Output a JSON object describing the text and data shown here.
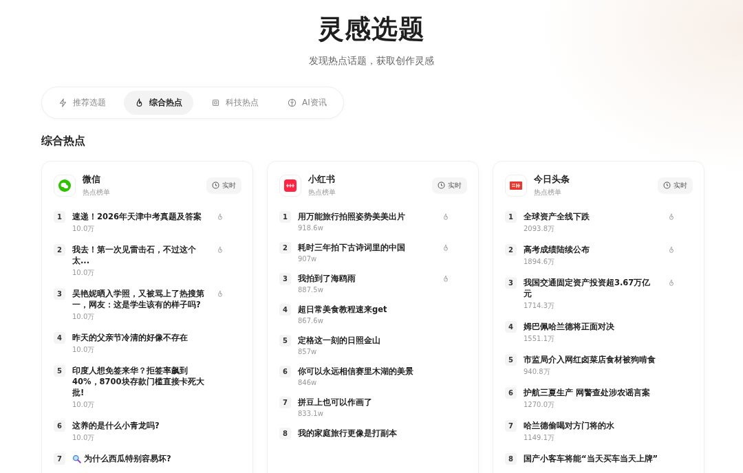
{
  "header": {
    "title": "灵感选题",
    "subtitle": "发现热点话题，获取创作灵感"
  },
  "tabs": [
    {
      "label": "推荐选题",
      "selected": false
    },
    {
      "label": "综合热点",
      "selected": true
    },
    {
      "label": "科技热点",
      "selected": false
    },
    {
      "label": "AI资讯",
      "selected": false
    }
  ],
  "section_title": "综合热点",
  "boards": [
    {
      "name": "微信",
      "subtitle": "热点榜单",
      "kind": "wechat",
      "badge": "实时",
      "items": [
        {
          "rank": "1",
          "title": "速递！2026年天津中考真题及答案",
          "count": "10.0万",
          "hot": true
        },
        {
          "rank": "2",
          "title": "我去！第一次见雷击石，不过这个太...",
          "count": "10.0万",
          "hot": true
        },
        {
          "rank": "3",
          "title": "吴艳妮晒入学照，又被骂上了热搜第一，网友：这是学生该有的样子吗?",
          "count": "10.0万",
          "hot": true
        },
        {
          "rank": "4",
          "title": "昨天的父亲节冷清的好像不存在",
          "count": "10.0万",
          "hot": false
        },
        {
          "rank": "5",
          "title": "印度人想免签来华？拒签率飙到40%，8700块存款门槛直接卡死大批!",
          "count": "10.0万",
          "hot": false
        },
        {
          "rank": "6",
          "title": "这养的是什么小青龙吗?",
          "count": "10.0万",
          "hot": false
        },
        {
          "rank": "7",
          "title": "为什么西瓜特别容易坏?",
          "search": true,
          "hot": false
        }
      ]
    },
    {
      "name": "小红书",
      "subtitle": "热点榜单",
      "kind": "xiaohongshu",
      "badge": "实时",
      "items": [
        {
          "rank": "1",
          "title": "用万能旅行拍照姿势美美出片",
          "count": "918.6w",
          "hot": true
        },
        {
          "rank": "2",
          "title": "耗时三年拍下古诗词里的中国",
          "count": "907w",
          "hot": true
        },
        {
          "rank": "3",
          "title": "我拍到了海鸥雨",
          "count": "887.5w",
          "hot": true
        },
        {
          "rank": "4",
          "title": "超日常美食教程速来get",
          "count": "867.6w",
          "hot": false
        },
        {
          "rank": "5",
          "title": "定格这一刻的日照金山",
          "count": "857w",
          "hot": false
        },
        {
          "rank": "6",
          "title": "你可以永远相信赛里木湖的美景",
          "count": "846w",
          "hot": false
        },
        {
          "rank": "7",
          "title": "拼豆上也可以作画了",
          "count": "833.1w",
          "hot": false
        },
        {
          "rank": "8",
          "title": "我的家庭旅行更像是打副本",
          "hot": false
        }
      ]
    },
    {
      "name": "今日头条",
      "subtitle": "热点榜单",
      "kind": "toutiao",
      "badge": "实时",
      "items": [
        {
          "rank": "1",
          "title": "全球资产全线下跌",
          "count": "2093.8万",
          "hot": true
        },
        {
          "rank": "2",
          "title": "高考成绩陆续公布",
          "count": "1894.6万",
          "hot": true
        },
        {
          "rank": "3",
          "title": "我国交通固定资产投资超3.67万亿元",
          "count": "1714.3万",
          "hot": true
        },
        {
          "rank": "4",
          "title": "姆巴佩哈兰德将正面对决",
          "count": "1551.1万",
          "hot": false
        },
        {
          "rank": "5",
          "title": "市监局介入网红卤菜店食材被狗啃食",
          "count": "940.8万",
          "hot": false
        },
        {
          "rank": "6",
          "title": "护航三夏生产 网警查处涉农谣言案",
          "count": "1270.0万",
          "hot": false
        },
        {
          "rank": "7",
          "title": "哈兰德偷喝对方门将的水",
          "count": "1149.1万",
          "hot": false
        },
        {
          "rank": "8",
          "title": "国产小客车将能“当天买车当天上牌”",
          "hot": false
        }
      ]
    }
  ]
}
